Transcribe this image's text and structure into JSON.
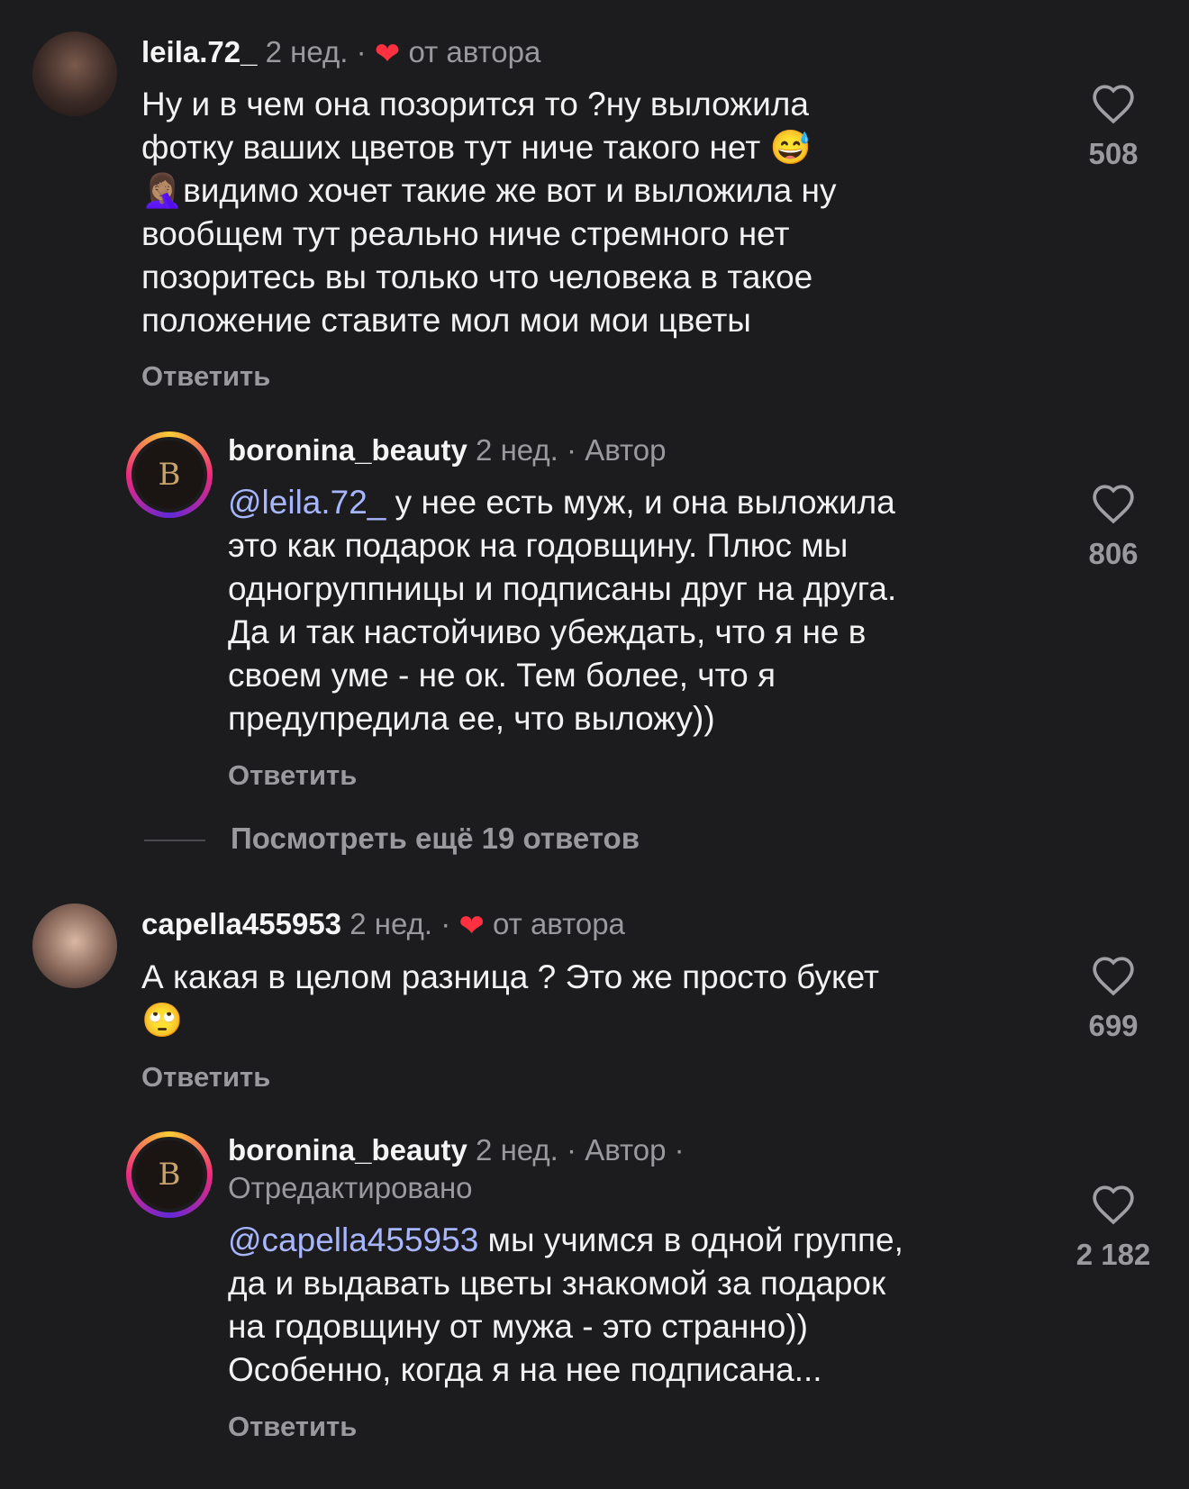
{
  "comments": [
    {
      "username": "leila.72_",
      "time": "2 нед.",
      "sep": "·",
      "author_like_label": "от автора",
      "lines": [
        "Ну и в чем она позорится то ?ну выложила",
        "фотку ваших цветов тут ниче такого нет 😅",
        "🤦🏽‍♀️видимо хочет такие же вот и выложила ну",
        "вообщем тут реально ниче стремного нет",
        "позоритесь вы только что человека в такое",
        "положение ставите мол мои мои цветы"
      ],
      "reply_label": "Ответить",
      "likes": "508"
    },
    {
      "username": "boronina_beauty",
      "time": "2 нед.",
      "sep": "·",
      "badge": "Автор",
      "mention": "@leila.72_",
      "lines": [
        " у нее есть муж, и она выложила",
        "это как подарок на годовщину. Плюс мы",
        "одногруппницы и подписаны друг на друга.",
        "Да и так настойчиво убеждать, что я не в",
        "своем уме - не ок. Тем более, что я",
        "предупредила ее, что выложу))"
      ],
      "reply_label": "Ответить",
      "likes": "806",
      "avatar_letter": "B"
    },
    {
      "username": "capella455953",
      "time": "2 нед.",
      "sep": "·",
      "author_like_label": "от автора",
      "lines": [
        "А какая в целом разница ? Это же просто букет",
        "🙄"
      ],
      "reply_label": "Ответить",
      "likes": "699"
    },
    {
      "username": "boronina_beauty",
      "time": "2 нед.",
      "sep": "·",
      "badge": "Автор ·",
      "edited": "Отредактировано",
      "mention": "@capella455953",
      "lines": [
        " мы учимся в одной группе,",
        "да и выдавать цветы знакомой за подарок",
        "на годовщину от мужа - это странно))",
        "Особенно, когда я на нее подписана..."
      ],
      "reply_label": "Ответить",
      "likes": "2 182",
      "avatar_letter": "B"
    }
  ],
  "view_more": "Посмотреть ещё 19 ответов",
  "colors": {
    "background": "#1c1c1e",
    "muted": "#9a9a9e",
    "mention": "#a7b6ff",
    "heart": "#ff3040"
  }
}
